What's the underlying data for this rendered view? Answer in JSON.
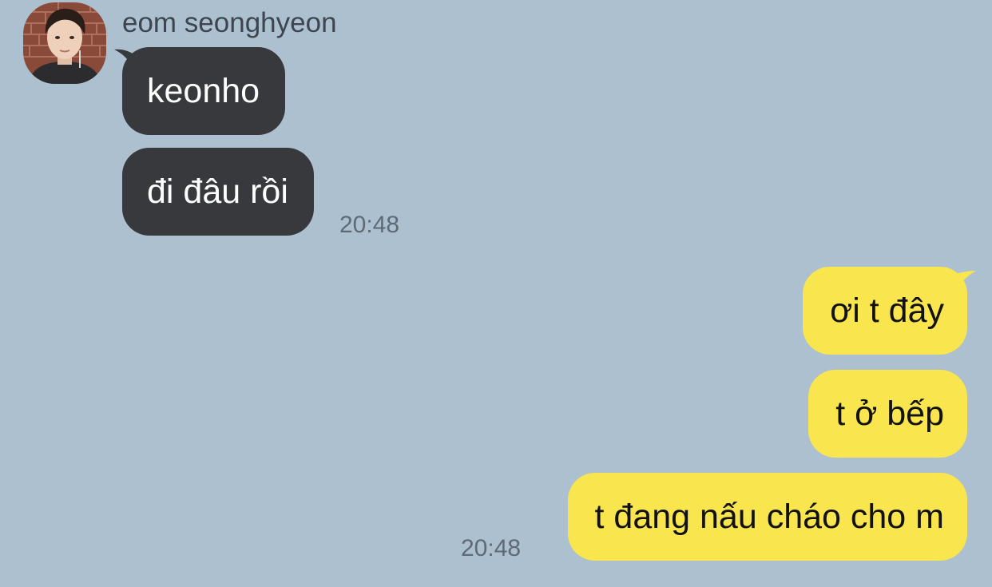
{
  "contact": {
    "name": "eom seonghyeon"
  },
  "incoming": {
    "messages": [
      "keonho",
      "đi đâu rồi"
    ],
    "time": "20:48"
  },
  "outgoing": {
    "messages": [
      "ơi t đây",
      "t ở bếp",
      "t đang nấu cháo cho m"
    ],
    "time": "20:48"
  },
  "colors": {
    "background": "#adc0d0",
    "incoming_bubble": "#38393c",
    "outgoing_bubble": "#f9e54d"
  }
}
